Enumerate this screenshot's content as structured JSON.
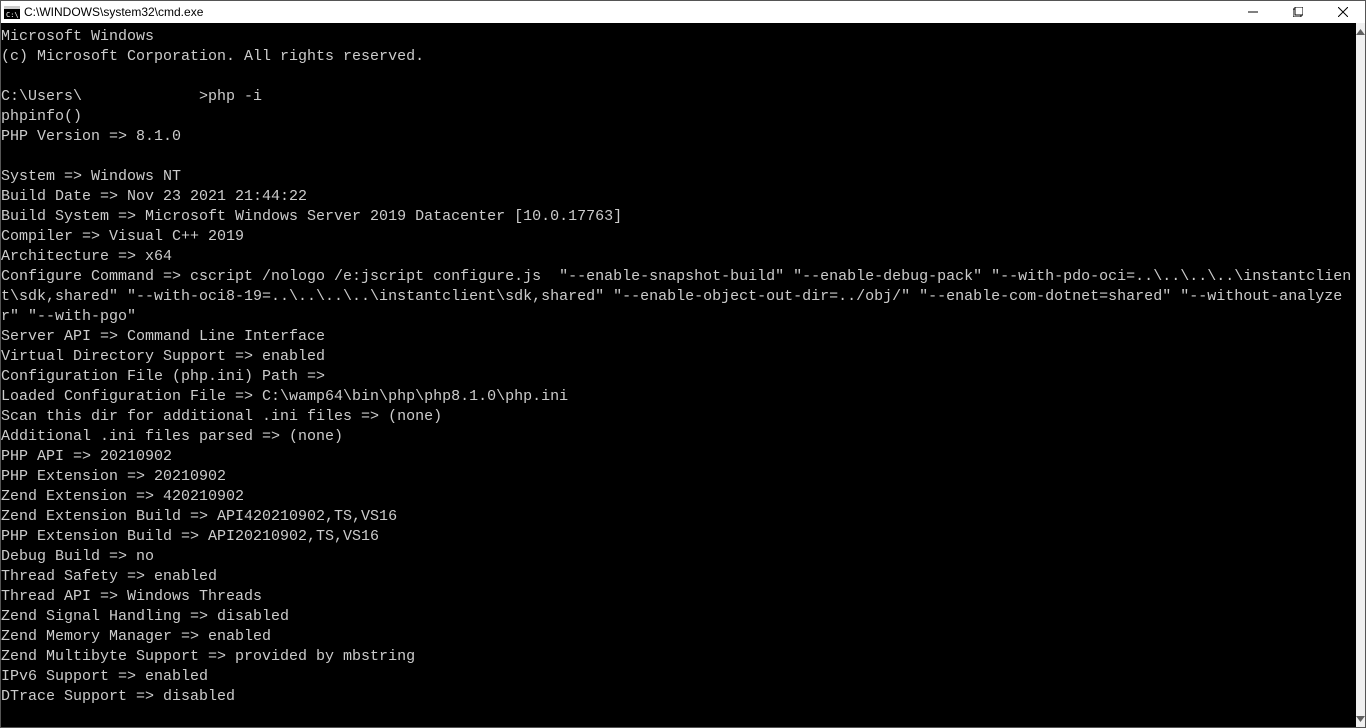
{
  "titlebar": {
    "title": "C:\\WINDOWS\\system32\\cmd.exe"
  },
  "terminal": {
    "lines": [
      "Microsoft Windows",
      "(c) Microsoft Corporation. All rights reserved.",
      "",
      "C:\\Users\\             >php -i",
      "phpinfo()",
      "PHP Version => 8.1.0",
      "",
      "System => Windows NT",
      "Build Date => Nov 23 2021 21:44:22",
      "Build System => Microsoft Windows Server 2019 Datacenter [10.0.17763]",
      "Compiler => Visual C++ 2019",
      "Architecture => x64",
      "Configure Command => cscript /nologo /e:jscript configure.js  \"--enable-snapshot-build\" \"--enable-debug-pack\" \"--with-pdo-oci=..\\..\\..\\..\\instantclient\\sdk,shared\" \"--with-oci8-19=..\\..\\..\\..\\instantclient\\sdk,shared\" \"--enable-object-out-dir=../obj/\" \"--enable-com-dotnet=shared\" \"--without-analyzer\" \"--with-pgo\"",
      "Server API => Command Line Interface",
      "Virtual Directory Support => enabled",
      "Configuration File (php.ini) Path =>",
      "Loaded Configuration File => C:\\wamp64\\bin\\php\\php8.1.0\\php.ini",
      "Scan this dir for additional .ini files => (none)",
      "Additional .ini files parsed => (none)",
      "PHP API => 20210902",
      "PHP Extension => 20210902",
      "Zend Extension => 420210902",
      "Zend Extension Build => API420210902,TS,VS16",
      "PHP Extension Build => API20210902,TS,VS16",
      "Debug Build => no",
      "Thread Safety => enabled",
      "Thread API => Windows Threads",
      "Zend Signal Handling => disabled",
      "Zend Memory Manager => enabled",
      "Zend Multibyte Support => provided by mbstring",
      "IPv6 Support => enabled",
      "DTrace Support => disabled"
    ]
  }
}
